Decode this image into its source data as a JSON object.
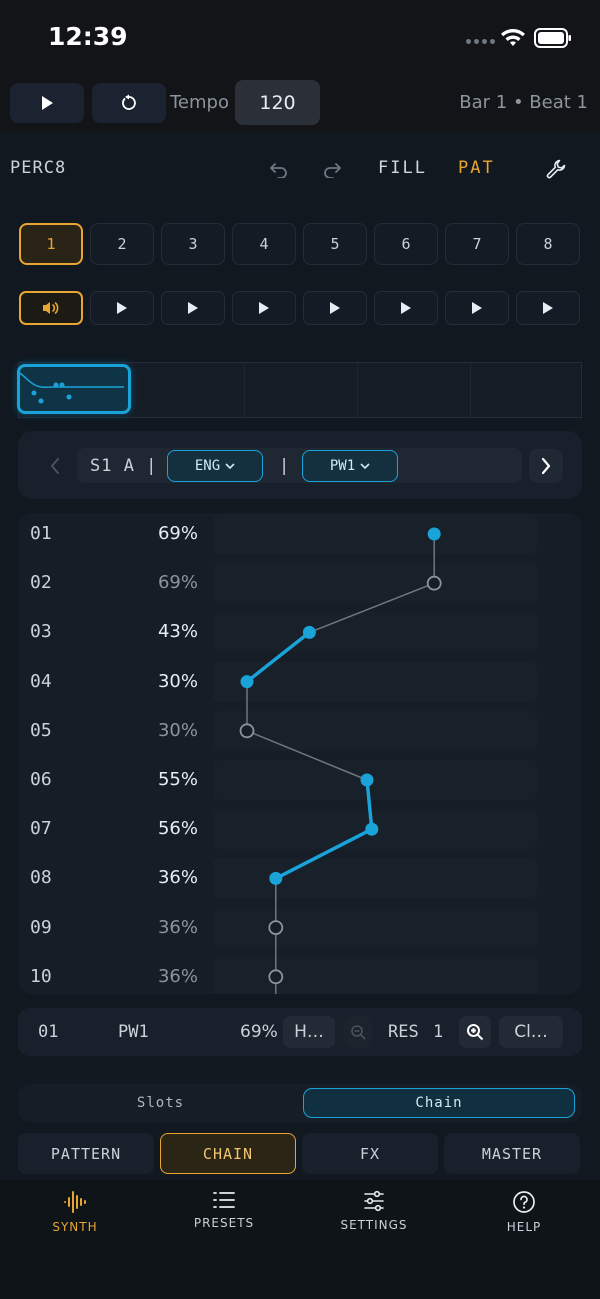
{
  "status": {
    "time": "12:39"
  },
  "transport": {
    "play_icon": "play-icon",
    "reset_icon": "reset-icon",
    "tempo_label": "Tempo",
    "tempo_value": "120",
    "position": "Bar 1 • Beat 1"
  },
  "toolbar": {
    "name": "PERC8",
    "fill": "FILL",
    "pat": "PAT"
  },
  "slots": [
    "1",
    "2",
    "3",
    "4",
    "5",
    "6",
    "7",
    "8"
  ],
  "selector": {
    "label": "S1 A |",
    "engine": "ENG",
    "separator": "|",
    "param": "PW1"
  },
  "steps": [
    {
      "idx": "01",
      "value": "69%",
      "pct": 69,
      "active": true
    },
    {
      "idx": "02",
      "value": "69%",
      "pct": 69,
      "active": false
    },
    {
      "idx": "03",
      "value": "43%",
      "pct": 43,
      "active": true
    },
    {
      "idx": "04",
      "value": "30%",
      "pct": 30,
      "active": true
    },
    {
      "idx": "05",
      "value": "30%",
      "pct": 30,
      "active": false
    },
    {
      "idx": "06",
      "value": "55%",
      "pct": 55,
      "active": true
    },
    {
      "idx": "07",
      "value": "56%",
      "pct": 56,
      "active": true
    },
    {
      "idx": "08",
      "value": "36%",
      "pct": 36,
      "active": true
    },
    {
      "idx": "09",
      "value": "36%",
      "pct": 36,
      "active": false
    },
    {
      "idx": "10",
      "value": "36%",
      "pct": 36,
      "active": false
    }
  ],
  "info": {
    "step": "01",
    "param": "PW1",
    "value": "69%",
    "h_button": "H…",
    "res_label": "RES",
    "res_value": "1",
    "clear_button": "Cl…"
  },
  "segment": {
    "slots": "Slots",
    "chain": "Chain"
  },
  "mode_tabs": [
    "PATTERN",
    "CHAIN",
    "FX",
    "MASTER"
  ],
  "tabbar": [
    "SYNTH",
    "PRESETS",
    "SETTINGS",
    "HELP"
  ],
  "colors": {
    "accent": "#e8a531",
    "cyan": "#1aa3d9",
    "bg": "#0d1117"
  }
}
